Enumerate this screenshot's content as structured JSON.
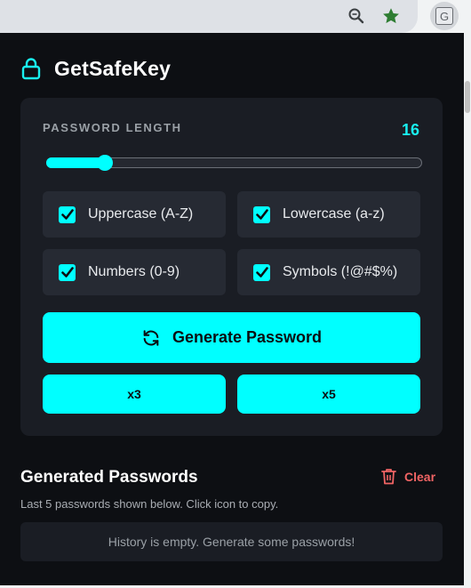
{
  "browser": {
    "icons": [
      "zoom-icon",
      "star-icon",
      "extension-icon"
    ],
    "extension_letter": "G"
  },
  "header": {
    "title": "GetSafeKey",
    "icon": "lock-icon"
  },
  "generator": {
    "length_label": "PASSWORD LENGTH",
    "length_value": "16",
    "slider_fraction": 0.155,
    "options": [
      {
        "label": "Uppercase (A-Z)",
        "checked": true
      },
      {
        "label": "Lowercase (a-z)",
        "checked": true
      },
      {
        "label": "Numbers (0-9)",
        "checked": true
      },
      {
        "label": "Symbols (!@#$%)",
        "checked": true
      }
    ],
    "generate_label": "Generate Password",
    "multi_buttons": [
      "x3",
      "x5"
    ]
  },
  "history": {
    "title": "Generated Passwords",
    "clear_label": "Clear",
    "subtitle": "Last 5 passwords shown below. Click icon to copy.",
    "empty_message": "History is empty. Generate some passwords!"
  },
  "colors": {
    "accent": "#00ffff",
    "danger": "#f06464",
    "background": "#0d0f13",
    "card": "#1a1d24"
  }
}
